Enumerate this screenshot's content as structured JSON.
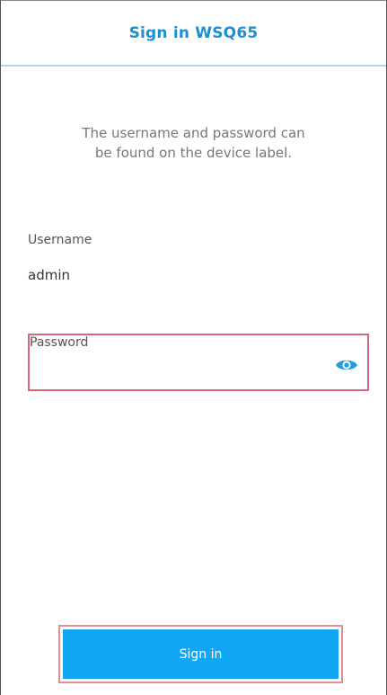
{
  "header": {
    "title": "Sign in WSQ65"
  },
  "instructions": {
    "line1": "The username and password can",
    "line2": "be found on the device label."
  },
  "username": {
    "label": "Username",
    "value": "admin"
  },
  "password": {
    "label": "Password",
    "value": "",
    "icon": "eye-icon"
  },
  "actions": {
    "sign_in_label": "Sign in"
  },
  "colors": {
    "accent": "#12a7f5",
    "title": "#1a8fd8",
    "highlight_border": "#d9667a"
  }
}
